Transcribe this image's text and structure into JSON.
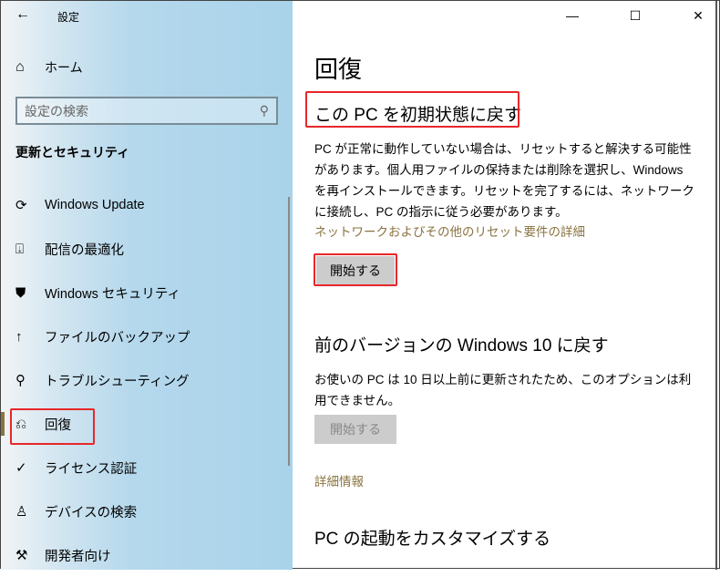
{
  "window": {
    "title": "設定",
    "minimize": "—",
    "maximize": "☐",
    "close": "✕",
    "back": "←"
  },
  "sidebar": {
    "home": "ホーム",
    "search_placeholder": "設定の検索",
    "section": "更新とセキュリティ",
    "items": [
      {
        "label": "Windows Update",
        "icon": "⟳"
      },
      {
        "label": "配信の最適化",
        "icon": "⍗"
      },
      {
        "label": "Windows セキュリティ",
        "icon": "⛊"
      },
      {
        "label": "ファイルのバックアップ",
        "icon": "↑"
      },
      {
        "label": "トラブルシューティング",
        "icon": "⚲"
      },
      {
        "label": "回復",
        "icon": "⎌"
      },
      {
        "label": "ライセンス認証",
        "icon": "✓"
      },
      {
        "label": "デバイスの検索",
        "icon": "♙"
      },
      {
        "label": "開発者向け",
        "icon": "⚒"
      }
    ]
  },
  "main": {
    "title": "回復",
    "reset": {
      "heading": "この PC を初期状態に戻す",
      "desc": "PC が正常に動作していない場合は、リセットすると解決する可能性があります。個人用ファイルの保持または削除を選択し、Windows を再インストールできます。リセットを完了するには、ネットワークに接続し、PC の指示に従う必要があります。",
      "link": "ネットワークおよびその他のリセット要件の詳細",
      "button": "開始する"
    },
    "goback": {
      "heading": "前のバージョンの Windows 10 に戻す",
      "desc": "お使いの PC は 10 日以上前に更新されたため、このオプションは利用できません。",
      "button": "開始する",
      "link": "詳細情報"
    },
    "startup": {
      "heading": "PC の起動をカスタマイズする"
    }
  },
  "colors": {
    "accent": "#8a7340",
    "highlight": "#e8272a"
  }
}
